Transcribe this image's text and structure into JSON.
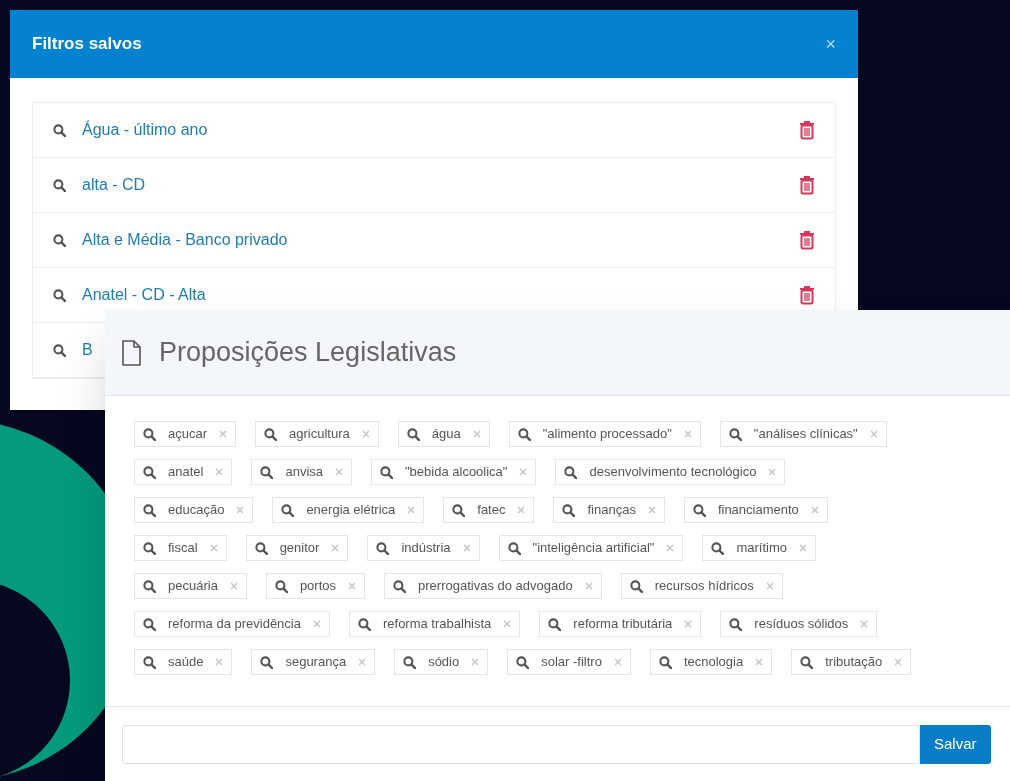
{
  "saved_filters": {
    "title": "Filtros salvos",
    "close": "×",
    "items": [
      {
        "label": "Água - último ano"
      },
      {
        "label": "alta - CD"
      },
      {
        "label": "Alta e Média - Banco privado"
      },
      {
        "label": "Anatel - CD - Alta"
      },
      {
        "label": "B"
      }
    ]
  },
  "proposicoes": {
    "title": "Proposições Legislativas",
    "tag_rows": [
      [
        "açucar",
        "agricultura",
        "água",
        "\"alimento processado\"",
        "\"análises clínicas\""
      ],
      [
        "anatel",
        "anvisa",
        "\"bebida alcoolica\"",
        "desenvolvimento tecnológico"
      ],
      [
        "educação",
        "energia elétrica",
        "fatec",
        "finanças",
        "financiamento"
      ],
      [
        "fiscal",
        "genitor",
        "indústria",
        "\"inteligência artificial\"",
        "marítimo"
      ],
      [
        "pecuária",
        "portos",
        "prerrogativas do advogado",
        "recursos hídricos"
      ],
      [
        "reforma da previdência",
        "reforma trabalhista",
        "reforma tributária",
        "resíduos sólidos"
      ],
      [
        "saúde",
        "segurança",
        "sódio",
        "solar -filtro",
        "tecnologia",
        "tributação"
      ]
    ],
    "save_button": "Salvar"
  }
}
